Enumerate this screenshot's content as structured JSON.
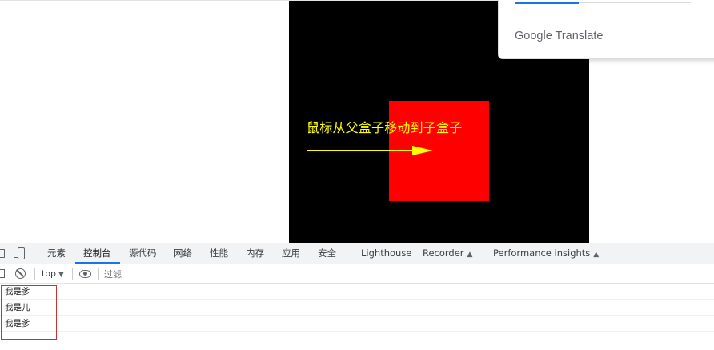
{
  "page": {
    "caption": "鼠标从父盒子移动到子盒子",
    "colors": {
      "parent_box": "#000000",
      "child_box": "#ff0000",
      "caption": "#ffff00",
      "arrow": "#ffff00"
    }
  },
  "translate_popup": {
    "brand": "Google Translate"
  },
  "devtools": {
    "icons": {
      "inspect": "inspect-element-icon",
      "device": "device-toolbar-icon",
      "sidebar": "console-sidebar-icon",
      "clear": "clear-console-icon",
      "eye": "live-expression-eye-icon",
      "flask": "experiment-flask-icon"
    },
    "tabs": [
      {
        "label": "元素"
      },
      {
        "label": "控制台",
        "active": true
      },
      {
        "label": "源代码"
      },
      {
        "label": "网络"
      },
      {
        "label": "性能"
      },
      {
        "label": "内存"
      },
      {
        "label": "应用"
      },
      {
        "label": "安全"
      },
      {
        "label": "Lighthouse"
      },
      {
        "label": "Recorder"
      },
      {
        "label": "Performance insights"
      }
    ],
    "toolbar": {
      "context": "top",
      "filter_placeholder": "过滤"
    },
    "console_lines": [
      "我是爹",
      "我是儿",
      "我是爹"
    ],
    "accent_color": "#1a73e8"
  }
}
